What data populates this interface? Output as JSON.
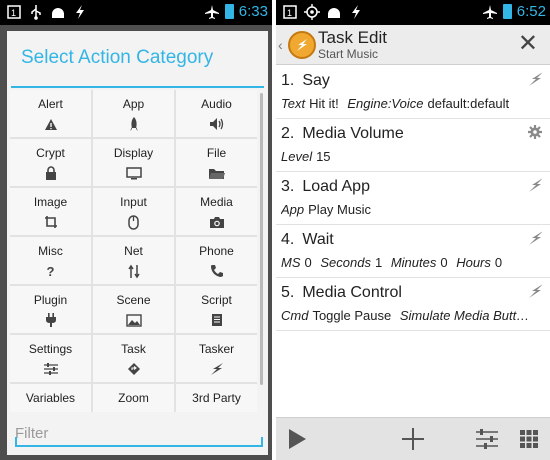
{
  "left_screen": {
    "status_bar": {
      "time": "6:33",
      "icons": [
        "notification-icon",
        "usb-icon",
        "android-icon",
        "flash-icon",
        "airplane-icon",
        "battery-icon"
      ]
    },
    "dialog": {
      "title": "Select Action Category",
      "categories": [
        {
          "label": "Alert",
          "icon": "warning-icon"
        },
        {
          "label": "App",
          "icon": "rocket-icon"
        },
        {
          "label": "Audio",
          "icon": "speaker-icon"
        },
        {
          "label": "Crypt",
          "icon": "lock-icon"
        },
        {
          "label": "Display",
          "icon": "monitor-icon"
        },
        {
          "label": "File",
          "icon": "folder-icon"
        },
        {
          "label": "Image",
          "icon": "crop-icon"
        },
        {
          "label": "Input",
          "icon": "mouse-icon"
        },
        {
          "label": "Media",
          "icon": "camera-icon"
        },
        {
          "label": "Misc",
          "icon": "question-icon"
        },
        {
          "label": "Net",
          "icon": "up-down-arrows-icon"
        },
        {
          "label": "Phone",
          "icon": "phone-icon"
        },
        {
          "label": "Plugin",
          "icon": "plug-icon"
        },
        {
          "label": "Scene",
          "icon": "picture-icon"
        },
        {
          "label": "Script",
          "icon": "script-icon"
        },
        {
          "label": "Settings",
          "icon": "sliders-icon"
        },
        {
          "label": "Task",
          "icon": "diamond-arrow-icon"
        },
        {
          "label": "Tasker",
          "icon": "lightning-icon"
        },
        {
          "label": "Variables",
          "icon": ""
        },
        {
          "label": "Zoom",
          "icon": ""
        },
        {
          "label": "3rd Party",
          "icon": ""
        }
      ],
      "filter_placeholder": "Filter"
    }
  },
  "right_screen": {
    "status_bar": {
      "time": "6:52",
      "icons": [
        "notification-icon",
        "location-icon",
        "android-icon",
        "flash-icon",
        "airplane-icon",
        "battery-icon"
      ]
    },
    "action_bar": {
      "title": "Task Edit",
      "subtitle": "Start Music"
    },
    "actions": [
      {
        "num": "1.",
        "name": "Say",
        "icon": "lightning-icon",
        "args": [
          {
            "k": "Text",
            "v": "Hit it!"
          },
          {
            "k": "Engine:Voice",
            "v": "default:default"
          }
        ]
      },
      {
        "num": "2.",
        "name": "Media Volume",
        "icon": "gear-icon",
        "args": [
          {
            "k": "Level",
            "v": "15"
          }
        ]
      },
      {
        "num": "3.",
        "name": "Load App",
        "icon": "lightning-icon",
        "args": [
          {
            "k": "App",
            "v": "Play Music"
          }
        ]
      },
      {
        "num": "4.",
        "name": "Wait",
        "icon": "lightning-icon",
        "args": [
          {
            "k": "MS",
            "v": "0"
          },
          {
            "k": "Seconds",
            "v": "1"
          },
          {
            "k": "Minutes",
            "v": "0"
          },
          {
            "k": "Hours",
            "v": "0"
          }
        ]
      },
      {
        "num": "5.",
        "name": "Media Control",
        "icon": "lightning-icon",
        "args": [
          {
            "k": "Cmd",
            "v": "Toggle Pause"
          },
          {
            "k": "Simulate Media Butt…",
            "v": ""
          }
        ]
      }
    ],
    "bottom_bar": [
      "play-icon",
      "add-icon",
      "sliders-icon",
      "grid-icon"
    ]
  },
  "colors": {
    "accent": "#33b5e5",
    "status_bar": "#000000",
    "dialog_bg": "#f3f3f3"
  }
}
